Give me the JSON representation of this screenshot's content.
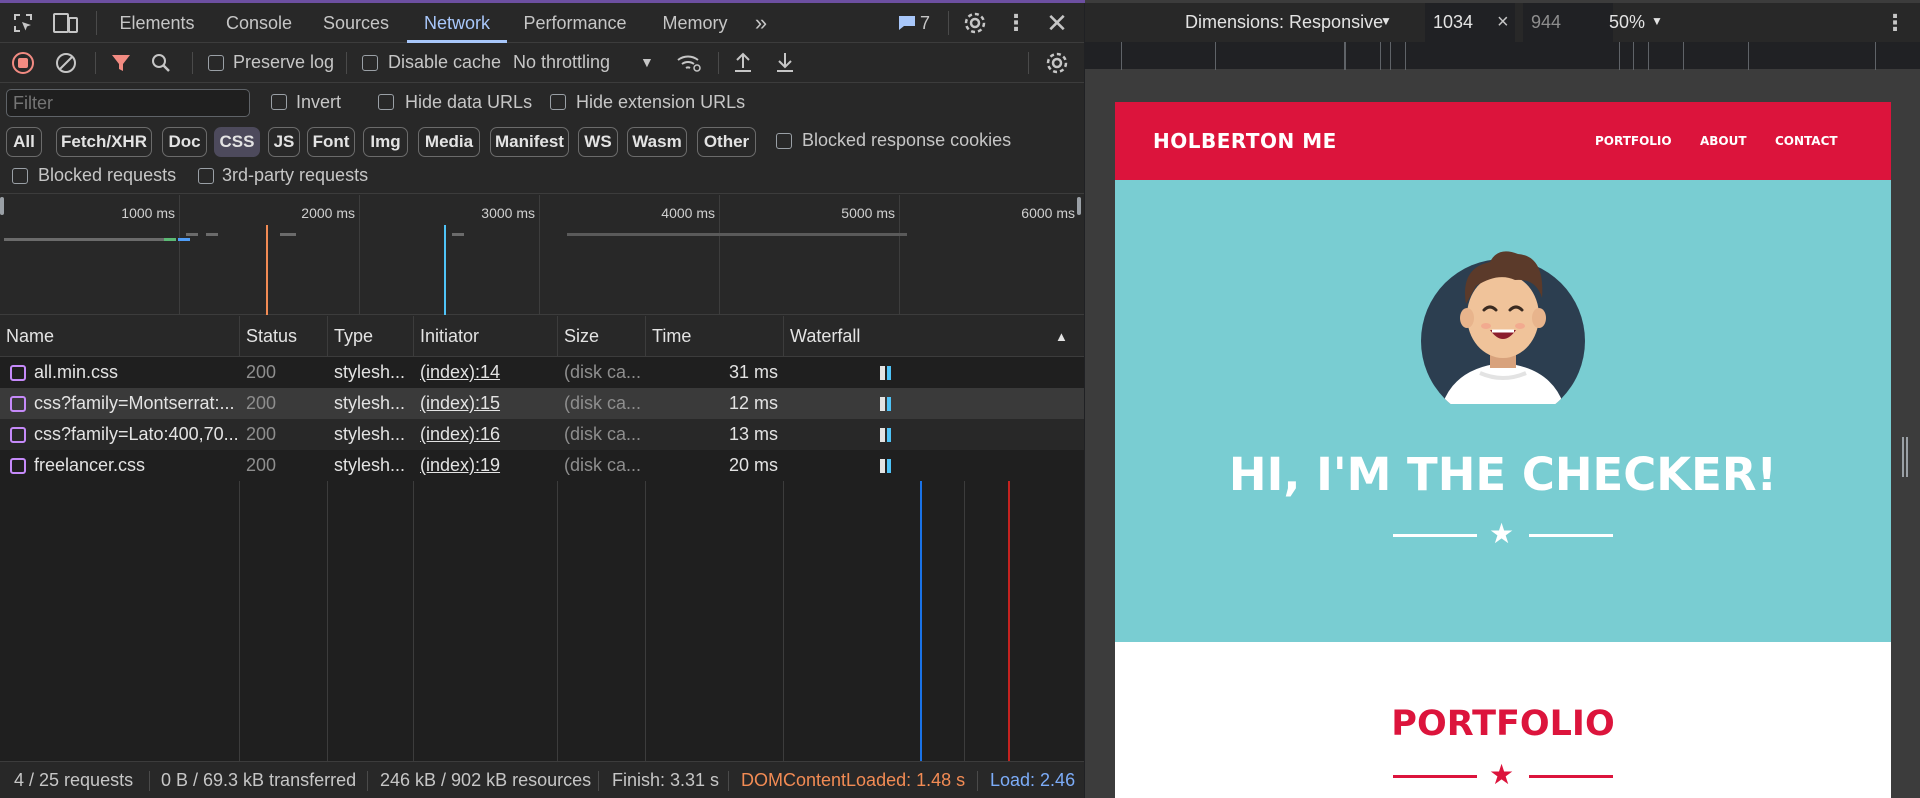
{
  "devtools": {
    "tabs": [
      {
        "label": "Elements"
      },
      {
        "label": "Console"
      },
      {
        "label": "Sources"
      },
      {
        "label": "Network"
      },
      {
        "label": "Performance"
      },
      {
        "label": "Memory"
      }
    ],
    "issues_count": "7",
    "toolbar": {
      "preserve_log": "Preserve log",
      "disable_cache": "Disable cache",
      "throttling": "No throttling"
    },
    "filter": {
      "placeholder": "Filter",
      "invert": "Invert",
      "hide_data_urls": "Hide data URLs",
      "hide_extension_urls": "Hide extension URLs",
      "types": [
        "All",
        "Fetch/XHR",
        "Doc",
        "CSS",
        "JS",
        "Font",
        "Img",
        "Media",
        "Manifest",
        "WS",
        "Wasm",
        "Other"
      ],
      "blocked_response_cookies": "Blocked response cookies",
      "blocked_requests": "Blocked requests",
      "third_party_requests": "3rd-party requests"
    },
    "overview": {
      "ticks": [
        "1000 ms",
        "2000 ms",
        "3000 ms",
        "4000 ms",
        "5000 ms",
        "6000 ms"
      ]
    },
    "columns": {
      "name": "Name",
      "status": "Status",
      "type": "Type",
      "initiator": "Initiator",
      "size": "Size",
      "time": "Time",
      "waterfall": "Waterfall"
    },
    "rows": [
      {
        "name": "all.min.css",
        "status": "200",
        "type": "stylesh...",
        "initiator": "(index):14",
        "size": "(disk ca...",
        "time": "31 ms"
      },
      {
        "name": "css?family=Montserrat:...",
        "status": "200",
        "type": "stylesh...",
        "initiator": "(index):15",
        "size": "(disk ca...",
        "time": "12 ms"
      },
      {
        "name": "css?family=Lato:400,70...",
        "status": "200",
        "type": "stylesh...",
        "initiator": "(index):16",
        "size": "(disk ca...",
        "time": "13 ms"
      },
      {
        "name": "freelancer.css",
        "status": "200",
        "type": "stylesh...",
        "initiator": "(index):19",
        "size": "(disk ca...",
        "time": "20 ms"
      }
    ],
    "status": {
      "requests": "4 / 25 requests",
      "transferred": "0 B / 69.3 kB transferred",
      "resources": "246 kB / 902 kB resources",
      "finish": "Finish: 3.31 s",
      "dom_content_loaded": "DOMContentLoaded: 1.48 s",
      "load": "Load: 2.46"
    },
    "colors": {
      "accent": "#a8c7fa",
      "dcl": "#f28b54",
      "load": "#7cacf8",
      "record": "#f28b82"
    }
  },
  "device": {
    "dimensions": "Dimensions: Responsive",
    "width": "1034",
    "times": "×",
    "height": "944",
    "zoom": "50%"
  },
  "page": {
    "brand": "HOLBERTON ME",
    "nav": [
      "PORTFOLIO",
      "ABOUT",
      "CONTACT"
    ],
    "hero_title": "HI, I'M THE CHECKER!",
    "section_title": "PORTFOLIO",
    "colors": {
      "primary": "#dc143c",
      "hero_bg": "#79cdd2"
    }
  }
}
